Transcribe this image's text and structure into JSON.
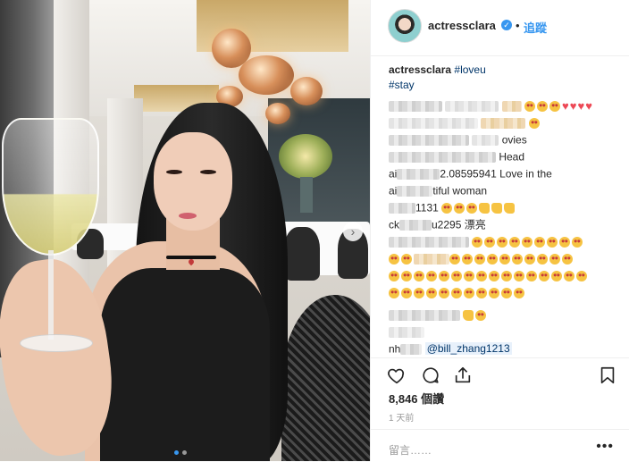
{
  "post": {
    "username": "actressclara",
    "verified_icon": "verified-badge-icon",
    "follow_separator": "•",
    "follow_label": "追蹤",
    "carousel": {
      "current_slide": 1,
      "total_slides": 2
    }
  },
  "caption": {
    "username": "actressclara",
    "text": "#loveu",
    "text2": "#stay"
  },
  "comments": {
    "row4_text": "漂亮",
    "row2_text": "ovies",
    "row3_text": "Head",
    "row4_prefix": "ai",
    "row4_suffix": "2.08595941 Love in the",
    "row5_prefix": "ai",
    "row5_suffix": "tiful woman",
    "row6_suffix": "1131",
    "row7_prefix": "ck",
    "row7_mid": "u2295",
    "row_mention_prefix": "nh",
    "mention": "@bill_zhang1213"
  },
  "actions": {
    "like_icon": "heart-outline-icon",
    "comment_icon": "comment-bubble-icon",
    "share_icon": "share-upload-icon",
    "save_icon": "bookmark-icon"
  },
  "likes": "8,846 個讚",
  "timestamp": "1 天前",
  "add_comment": {
    "placeholder": "留言……",
    "more": "•••"
  }
}
